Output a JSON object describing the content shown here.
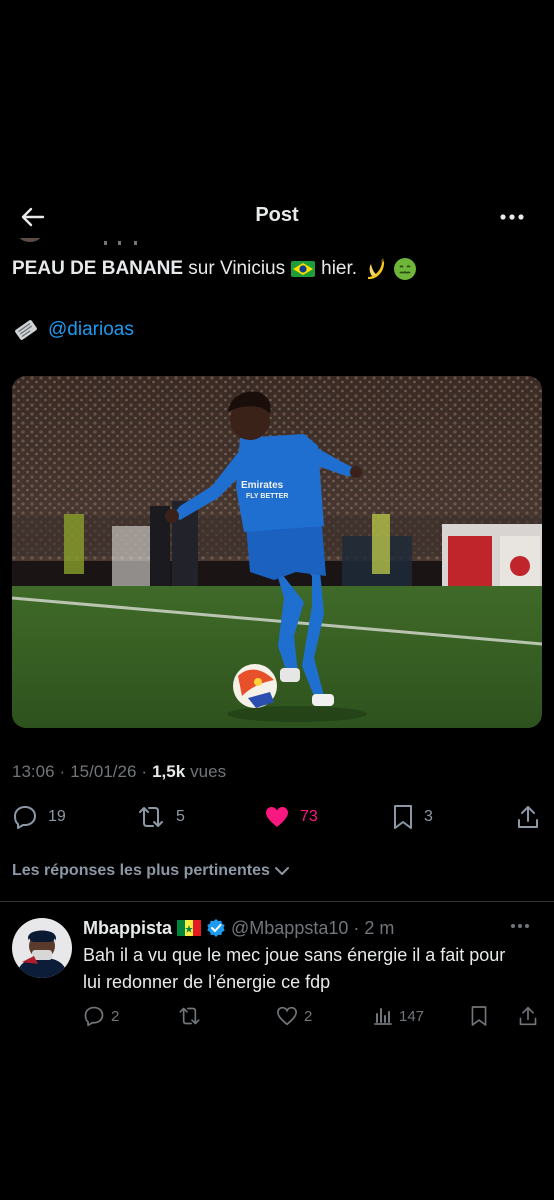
{
  "header": {
    "title": "Post"
  },
  "post": {
    "text_bold": "PEAU DE BANANE",
    "text_rest": " sur Vinicius",
    "text_after_flag": "hier.",
    "source_handle": "@diarioas",
    "time": "13:06",
    "separator": "·",
    "date": "15/01/26",
    "views_count": "1,5k",
    "views_label": "vues",
    "photo_shirt_text": "Emirates FLY BETTER"
  },
  "actions": {
    "replies": "19",
    "reposts": "5",
    "likes": "73",
    "bookmarks": "3"
  },
  "relevant_replies_label": "Les réponses les plus pertinentes",
  "reply": {
    "name": "Mbappista",
    "handle": "@Mbappsta10",
    "time": "2 m",
    "separator": "·",
    "text": "Bah il a vu que le mec joue sans énergie il a fait pour lui redonner de l’énergie ce fdp",
    "replies": "2",
    "likes": "2",
    "views": "147"
  },
  "icons": [
    "back-arrow-icon",
    "more-icon",
    "brazil-flag-icon",
    "banana-icon",
    "nauseated-face-icon",
    "newspaper-icon",
    "reply-icon",
    "repost-icon",
    "heart-icon",
    "bookmark-icon",
    "share-icon",
    "chevron-down-icon",
    "senegal-flag-icon",
    "verified-badge-icon",
    "views-icon"
  ],
  "colors": {
    "background": "#000000",
    "text": "#e7e9ea",
    "muted": "#71767b",
    "link": "#1d9bf0",
    "like": "#f91880",
    "verified": "#1d9bf0"
  }
}
